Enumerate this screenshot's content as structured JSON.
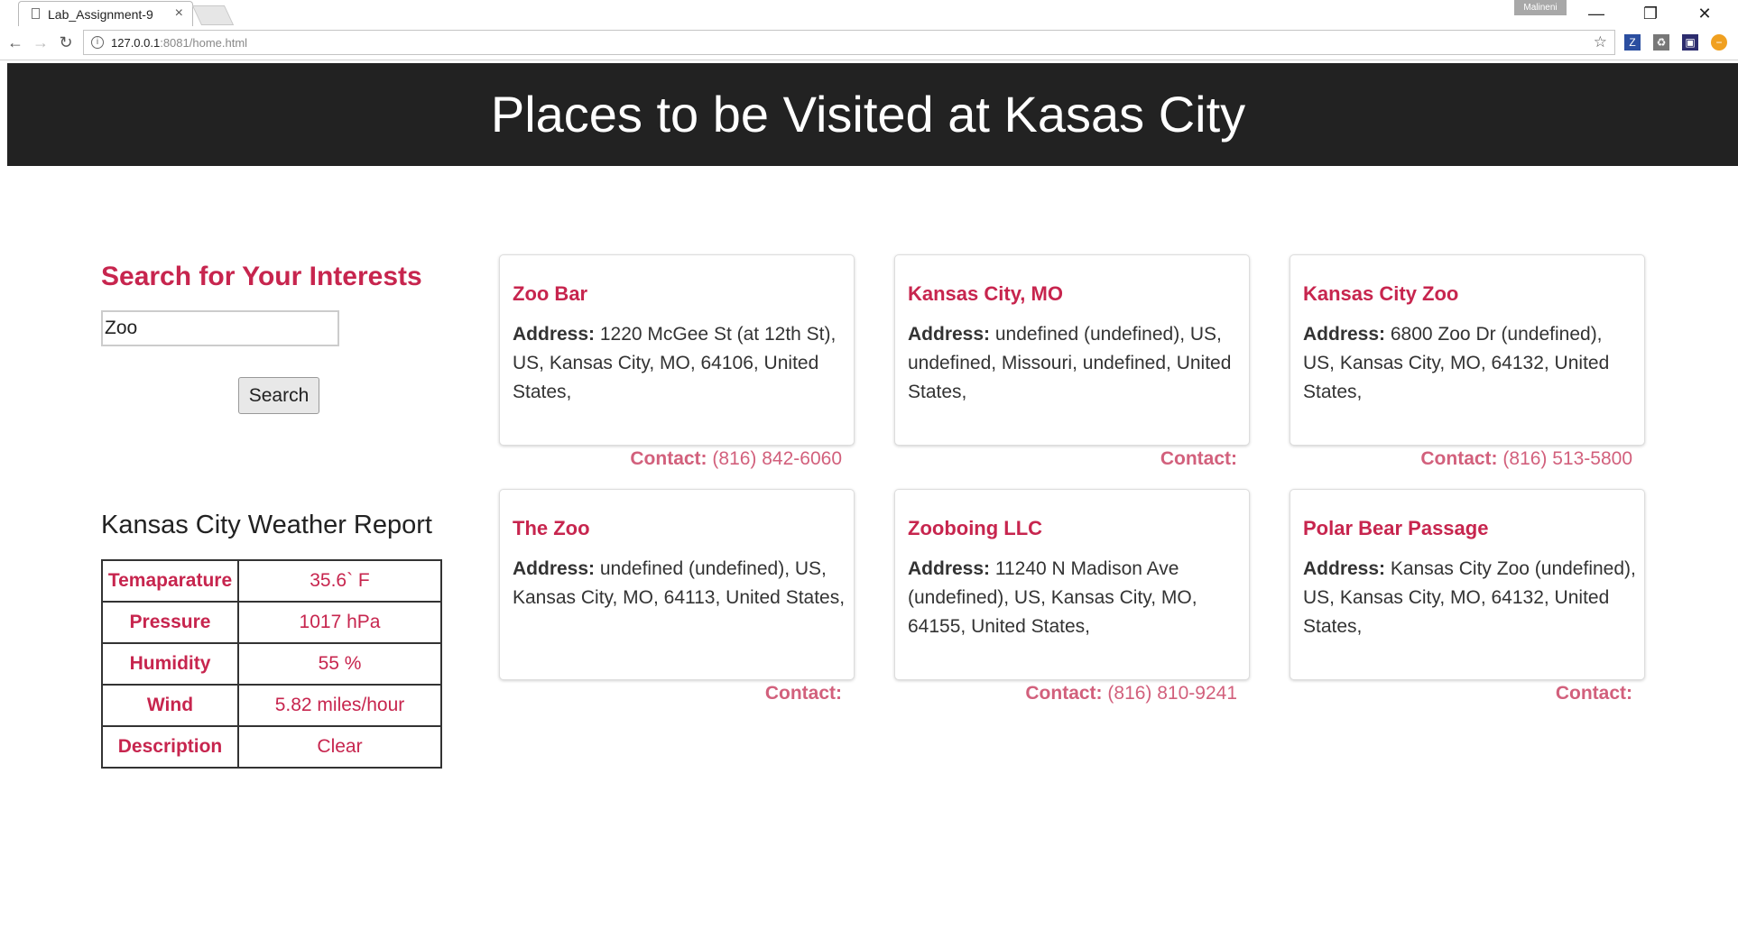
{
  "browser": {
    "tab_title": "Lab_Assignment-9",
    "tab_close": "×",
    "user_badge": "Malineni",
    "url_host": "127.0.0.1",
    "url_rest": ":8081/home.html",
    "buttons": {
      "back": "←",
      "forward": "→",
      "reload": "↻",
      "star": "☆",
      "minimize": "—",
      "restore": "❐",
      "close": "✕"
    },
    "extensions": [
      {
        "name": "z-extension-icon",
        "glyph": "Z",
        "color": "#2b4ea0"
      },
      {
        "name": "recycle-extension-icon",
        "glyph": "♻",
        "color": "#777777"
      },
      {
        "name": "reader-extension-icon",
        "glyph": "▣",
        "color": "#2c2c6e"
      },
      {
        "name": "orange-extension-icon",
        "glyph": "−",
        "color": "#f0a020"
      }
    ]
  },
  "page": {
    "heading": "Places to be Visited at Kasas City",
    "search": {
      "title": "Search for Your Interests",
      "value": "Zoo",
      "button": "Search"
    },
    "weather": {
      "title": "Kansas City Weather Report",
      "rows": [
        {
          "label": "Temaparature",
          "value": "35.6` F"
        },
        {
          "label": "Pressure",
          "value": "1017 hPa"
        },
        {
          "label": "Humidity",
          "value": "55 %"
        },
        {
          "label": "Wind",
          "value": "5.82 miles/hour"
        },
        {
          "label": "Description",
          "value": "Clear"
        }
      ]
    },
    "address_label": "Address:",
    "contact_label": "Contact:",
    "places": [
      {
        "name": "Zoo Bar",
        "address": "1220 McGee St (at 12th St), US, Kansas City, MO, 64106, United States,",
        "phone": "(816) 842-6060"
      },
      {
        "name": "Kansas City, MO",
        "address": "undefined (undefined), US, undefined, Missouri, undefined, United States,",
        "phone": ""
      },
      {
        "name": "Kansas City Zoo",
        "address": "6800 Zoo Dr (undefined), US, Kansas City, MO, 64132, United States,",
        "phone": "(816) 513-5800"
      },
      {
        "name": "The Zoo",
        "address": "undefined (undefined), US, Kansas City, MO, 64113, United States,",
        "phone": ""
      },
      {
        "name": "Zooboing LLC",
        "address": "11240 N Madison Ave (undefined), US, Kansas City, MO, 64155, United States,",
        "phone": "(816) 810-9241"
      },
      {
        "name": "Polar Bear Passage",
        "address": "Kansas City Zoo (undefined), US, Kansas City, MO, 64132, United States,",
        "phone": ""
      }
    ]
  }
}
